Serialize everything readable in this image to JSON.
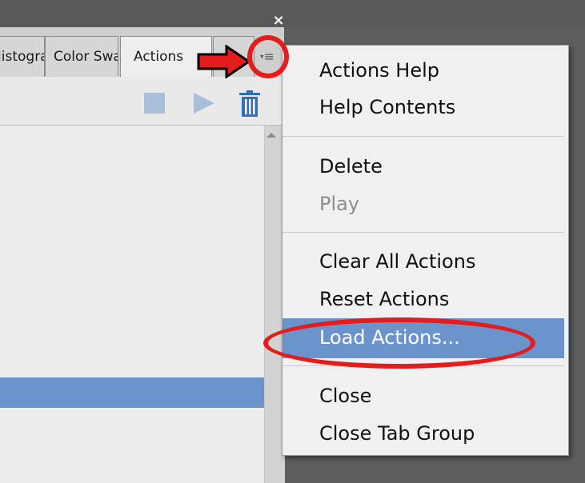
{
  "window": {
    "close_glyph": "×"
  },
  "panel": {
    "tabs": [
      {
        "label": "Histogram"
      },
      {
        "label": "Color Swatches"
      },
      {
        "label": "Actions"
      },
      {
        "label": ""
      }
    ],
    "menu_button_glyph": "≡",
    "menu_button_chevron": "▾",
    "toolbar": {
      "stop_icon": "stop-icon",
      "play_icon": "play-icon",
      "trash_icon": "trash-icon",
      "icon_color": "#a9bfd9",
      "trash_color": "#2f6fbf"
    },
    "selected_row_color": "#6b94cc"
  },
  "menu": {
    "items": [
      {
        "label": "Actions Help"
      },
      {
        "label": "Help Contents"
      },
      {
        "label": "Delete"
      },
      {
        "label": "Play",
        "disabled": true
      },
      {
        "label": "Clear All Actions"
      },
      {
        "label": "Reset Actions"
      },
      {
        "label": "Load Actions...",
        "highlighted": true
      },
      {
        "label": "Close"
      },
      {
        "label": "Close Tab Group"
      }
    ],
    "highlight_color": "#6b94cc"
  },
  "annotations": {
    "color": "#e51c1c"
  }
}
